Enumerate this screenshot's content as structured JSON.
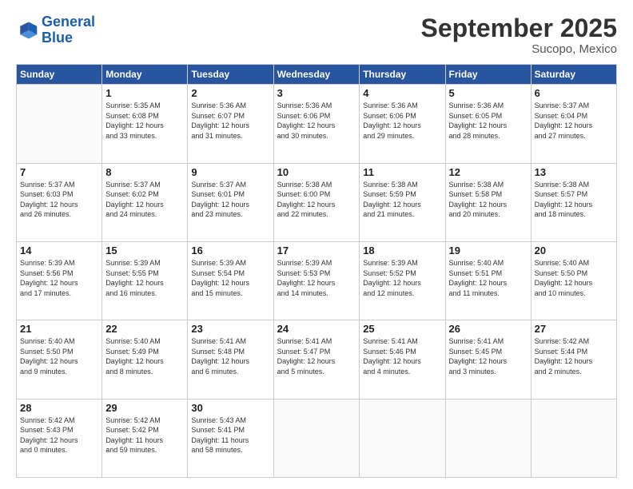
{
  "logo": {
    "line1": "General",
    "line2": "Blue"
  },
  "header": {
    "month": "September 2025",
    "location": "Sucopo, Mexico"
  },
  "weekdays": [
    "Sunday",
    "Monday",
    "Tuesday",
    "Wednesday",
    "Thursday",
    "Friday",
    "Saturday"
  ],
  "weeks": [
    [
      {
        "day": "",
        "info": ""
      },
      {
        "day": "1",
        "info": "Sunrise: 5:35 AM\nSunset: 6:08 PM\nDaylight: 12 hours\nand 33 minutes."
      },
      {
        "day": "2",
        "info": "Sunrise: 5:36 AM\nSunset: 6:07 PM\nDaylight: 12 hours\nand 31 minutes."
      },
      {
        "day": "3",
        "info": "Sunrise: 5:36 AM\nSunset: 6:06 PM\nDaylight: 12 hours\nand 30 minutes."
      },
      {
        "day": "4",
        "info": "Sunrise: 5:36 AM\nSunset: 6:06 PM\nDaylight: 12 hours\nand 29 minutes."
      },
      {
        "day": "5",
        "info": "Sunrise: 5:36 AM\nSunset: 6:05 PM\nDaylight: 12 hours\nand 28 minutes."
      },
      {
        "day": "6",
        "info": "Sunrise: 5:37 AM\nSunset: 6:04 PM\nDaylight: 12 hours\nand 27 minutes."
      }
    ],
    [
      {
        "day": "7",
        "info": "Sunrise: 5:37 AM\nSunset: 6:03 PM\nDaylight: 12 hours\nand 26 minutes."
      },
      {
        "day": "8",
        "info": "Sunrise: 5:37 AM\nSunset: 6:02 PM\nDaylight: 12 hours\nand 24 minutes."
      },
      {
        "day": "9",
        "info": "Sunrise: 5:37 AM\nSunset: 6:01 PM\nDaylight: 12 hours\nand 23 minutes."
      },
      {
        "day": "10",
        "info": "Sunrise: 5:38 AM\nSunset: 6:00 PM\nDaylight: 12 hours\nand 22 minutes."
      },
      {
        "day": "11",
        "info": "Sunrise: 5:38 AM\nSunset: 5:59 PM\nDaylight: 12 hours\nand 21 minutes."
      },
      {
        "day": "12",
        "info": "Sunrise: 5:38 AM\nSunset: 5:58 PM\nDaylight: 12 hours\nand 20 minutes."
      },
      {
        "day": "13",
        "info": "Sunrise: 5:38 AM\nSunset: 5:57 PM\nDaylight: 12 hours\nand 18 minutes."
      }
    ],
    [
      {
        "day": "14",
        "info": "Sunrise: 5:39 AM\nSunset: 5:56 PM\nDaylight: 12 hours\nand 17 minutes."
      },
      {
        "day": "15",
        "info": "Sunrise: 5:39 AM\nSunset: 5:55 PM\nDaylight: 12 hours\nand 16 minutes."
      },
      {
        "day": "16",
        "info": "Sunrise: 5:39 AM\nSunset: 5:54 PM\nDaylight: 12 hours\nand 15 minutes."
      },
      {
        "day": "17",
        "info": "Sunrise: 5:39 AM\nSunset: 5:53 PM\nDaylight: 12 hours\nand 14 minutes."
      },
      {
        "day": "18",
        "info": "Sunrise: 5:39 AM\nSunset: 5:52 PM\nDaylight: 12 hours\nand 12 minutes."
      },
      {
        "day": "19",
        "info": "Sunrise: 5:40 AM\nSunset: 5:51 PM\nDaylight: 12 hours\nand 11 minutes."
      },
      {
        "day": "20",
        "info": "Sunrise: 5:40 AM\nSunset: 5:50 PM\nDaylight: 12 hours\nand 10 minutes."
      }
    ],
    [
      {
        "day": "21",
        "info": "Sunrise: 5:40 AM\nSunset: 5:50 PM\nDaylight: 12 hours\nand 9 minutes."
      },
      {
        "day": "22",
        "info": "Sunrise: 5:40 AM\nSunset: 5:49 PM\nDaylight: 12 hours\nand 8 minutes."
      },
      {
        "day": "23",
        "info": "Sunrise: 5:41 AM\nSunset: 5:48 PM\nDaylight: 12 hours\nand 6 minutes."
      },
      {
        "day": "24",
        "info": "Sunrise: 5:41 AM\nSunset: 5:47 PM\nDaylight: 12 hours\nand 5 minutes."
      },
      {
        "day": "25",
        "info": "Sunrise: 5:41 AM\nSunset: 5:46 PM\nDaylight: 12 hours\nand 4 minutes."
      },
      {
        "day": "26",
        "info": "Sunrise: 5:41 AM\nSunset: 5:45 PM\nDaylight: 12 hours\nand 3 minutes."
      },
      {
        "day": "27",
        "info": "Sunrise: 5:42 AM\nSunset: 5:44 PM\nDaylight: 12 hours\nand 2 minutes."
      }
    ],
    [
      {
        "day": "28",
        "info": "Sunrise: 5:42 AM\nSunset: 5:43 PM\nDaylight: 12 hours\nand 0 minutes."
      },
      {
        "day": "29",
        "info": "Sunrise: 5:42 AM\nSunset: 5:42 PM\nDaylight: 11 hours\nand 59 minutes."
      },
      {
        "day": "30",
        "info": "Sunrise: 5:43 AM\nSunset: 5:41 PM\nDaylight: 11 hours\nand 58 minutes."
      },
      {
        "day": "",
        "info": ""
      },
      {
        "day": "",
        "info": ""
      },
      {
        "day": "",
        "info": ""
      },
      {
        "day": "",
        "info": ""
      }
    ]
  ]
}
